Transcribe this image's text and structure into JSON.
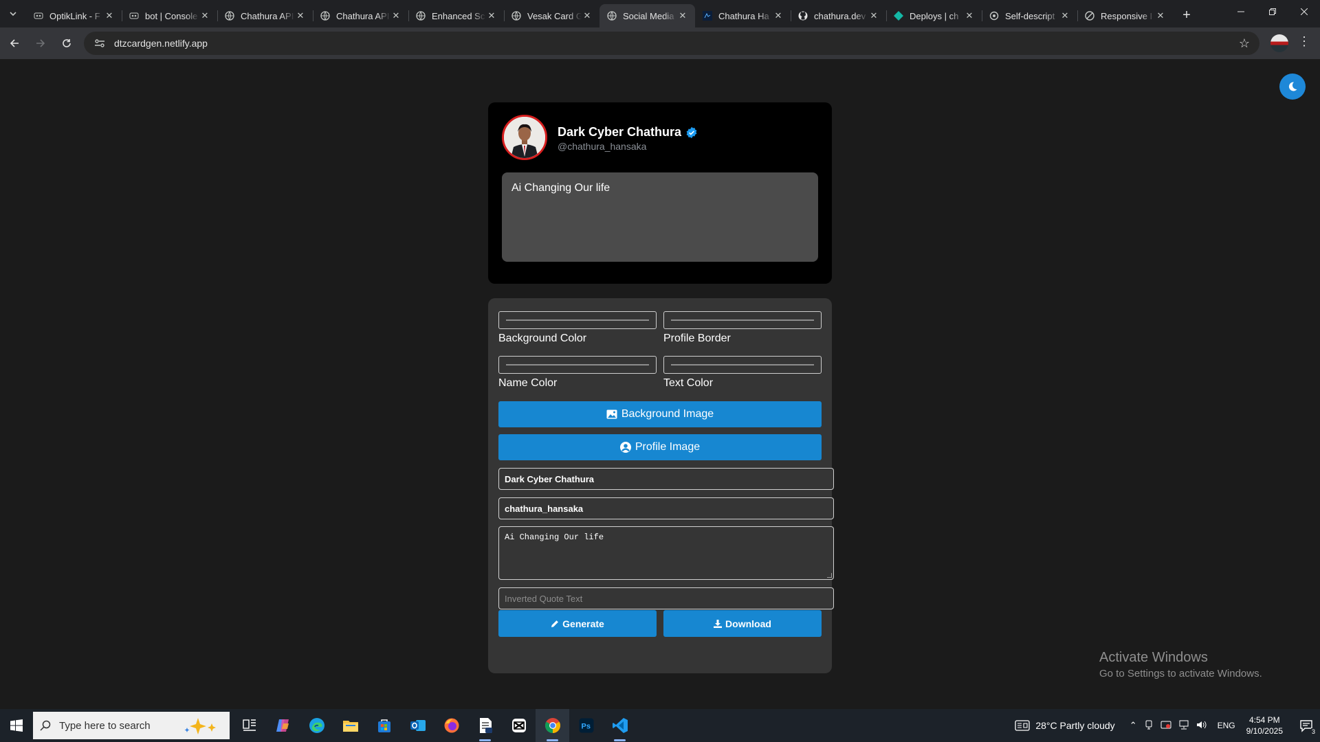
{
  "browser": {
    "tabs": [
      {
        "title": "OptikLink - F",
        "active": false
      },
      {
        "title": "bot | Console",
        "active": false
      },
      {
        "title": "Chathura API",
        "active": false
      },
      {
        "title": "Chathura API",
        "active": false
      },
      {
        "title": "Enhanced Sc",
        "active": false
      },
      {
        "title": "Vesak Card G",
        "active": false
      },
      {
        "title": "Social Media",
        "active": true
      },
      {
        "title": "Chathura Ha",
        "active": false
      },
      {
        "title": "chathura.dev",
        "active": false
      },
      {
        "title": "Deploys | ch",
        "active": false
      },
      {
        "title": "Self-descript",
        "active": false
      },
      {
        "title": "Responsive I",
        "active": false
      }
    ],
    "url": "dtzcardgen.netlify.app"
  },
  "card": {
    "name": "Dark Cyber Chathura",
    "handle": "@chathura_hansaka",
    "quote": "Ai Changing Our life"
  },
  "form": {
    "background_color_label": "Background Color",
    "profile_border_label": "Profile Border",
    "name_color_label": "Name Color",
    "text_color_label": "Text Color",
    "background_image_label": "Background Image",
    "profile_image_label": "Profile Image",
    "name_value": "Dark Cyber Chathura",
    "username_value": "chathura_hansaka",
    "quote_value": "Ai Changing Our life",
    "inverted_quote_placeholder": "Inverted Quote Text",
    "generate_label": "Generate",
    "download_label": "Download"
  },
  "watermark": {
    "title": "Activate Windows",
    "subtitle": "Go to Settings to activate Windows."
  },
  "taskbar": {
    "search_placeholder": "Type here to search",
    "weather": "28°C  Partly cloudy",
    "lang": "ENG",
    "time": "4:54 PM",
    "date": "9/10/2025",
    "notification_count": "3"
  },
  "colors": {
    "accent": "#1787d1",
    "card_bg": "#000000",
    "panel_bg": "#353535",
    "page_bg": "#1b1b1b",
    "profile_border": "#d61f1f"
  }
}
